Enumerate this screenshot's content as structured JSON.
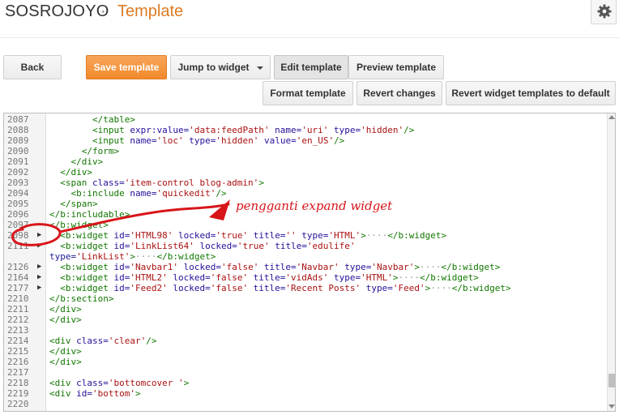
{
  "header": {
    "blog_name": "SOSROJOYO",
    "separator": "·",
    "page": "Template",
    "settings_icon": "gear-icon"
  },
  "toolbar": {
    "back": "Back",
    "save_template": "Save template",
    "jump_to_widget": "Jump to widget",
    "edit_template": "Edit template",
    "preview_template": "Preview template",
    "format_template": "Format template",
    "revert_changes": "Revert changes",
    "revert_widget_templates": "Revert widget templates to default"
  },
  "colors": {
    "accent": "#f28a2b",
    "annotation": "#d8151a",
    "tag": "#117700",
    "attr": "#221199",
    "string": "#aa1111"
  },
  "editor": {
    "lines": [
      {
        "n": "2087",
        "fold": "",
        "code": "        </table>"
      },
      {
        "n": "2088",
        "fold": "",
        "code": "        <input expr:value='data:feedPath' name='uri' type='hidden'/>"
      },
      {
        "n": "2089",
        "fold": "",
        "code": "        <input name='loc' type='hidden' value='en_US'/>"
      },
      {
        "n": "2090",
        "fold": "",
        "code": "      </form>"
      },
      {
        "n": "2091",
        "fold": "",
        "code": "    </div>"
      },
      {
        "n": "2092",
        "fold": "",
        "code": "  </div>"
      },
      {
        "n": "2093",
        "fold": "",
        "code": "  <span class='item-control blog-admin'>"
      },
      {
        "n": "2094",
        "fold": "",
        "code": "    <b:include name='quickedit'/>"
      },
      {
        "n": "2095",
        "fold": "",
        "code": "  </span>"
      },
      {
        "n": "2096",
        "fold": "",
        "code": "</b:includable>"
      },
      {
        "n": "2097",
        "fold": "",
        "code": "</b:widget>"
      },
      {
        "n": "2098",
        "fold": "▶",
        "code": "  <b:widget id='HTML98' locked='true' title='' type='HTML'>····</b:widget>"
      },
      {
        "n": "2111",
        "fold": "▶",
        "code": "  <b:widget id='LinkList64' locked='true' title='edulife'"
      },
      {
        "n": "",
        "fold": "",
        "code": "type='LinkList'>····</b:widget>"
      },
      {
        "n": "2126",
        "fold": "▶",
        "code": "  <b:widget id='Navbar1' locked='false' title='Navbar' type='Navbar'>····</b:widget>"
      },
      {
        "n": "2164",
        "fold": "▶",
        "code": "  <b:widget id='HTML2' locked='false' title='vidAds' type='HTML'>····</b:widget>"
      },
      {
        "n": "2177",
        "fold": "▶",
        "code": "  <b:widget id='Feed2' locked='false' title='Recent Posts' type='Feed'>····</b:widget>"
      },
      {
        "n": "2210",
        "fold": "",
        "code": "</b:section>"
      },
      {
        "n": "2211",
        "fold": "",
        "code": "</div>"
      },
      {
        "n": "2212",
        "fold": "",
        "code": "</div>"
      },
      {
        "n": "2213",
        "fold": "",
        "code": ""
      },
      {
        "n": "2214",
        "fold": "",
        "code": "<div class='clear'/>"
      },
      {
        "n": "2215",
        "fold": "",
        "code": "</div>"
      },
      {
        "n": "2216",
        "fold": "",
        "code": "</div>"
      },
      {
        "n": "2217",
        "fold": "",
        "code": ""
      },
      {
        "n": "2218",
        "fold": "",
        "code": "<div class='bottomcover '>"
      },
      {
        "n": "2219",
        "fold": "",
        "code": "<div id='bottom'>"
      },
      {
        "n": "2220",
        "fold": "",
        "code": ""
      }
    ]
  },
  "annotation": {
    "text": "pengganti expand widget"
  }
}
